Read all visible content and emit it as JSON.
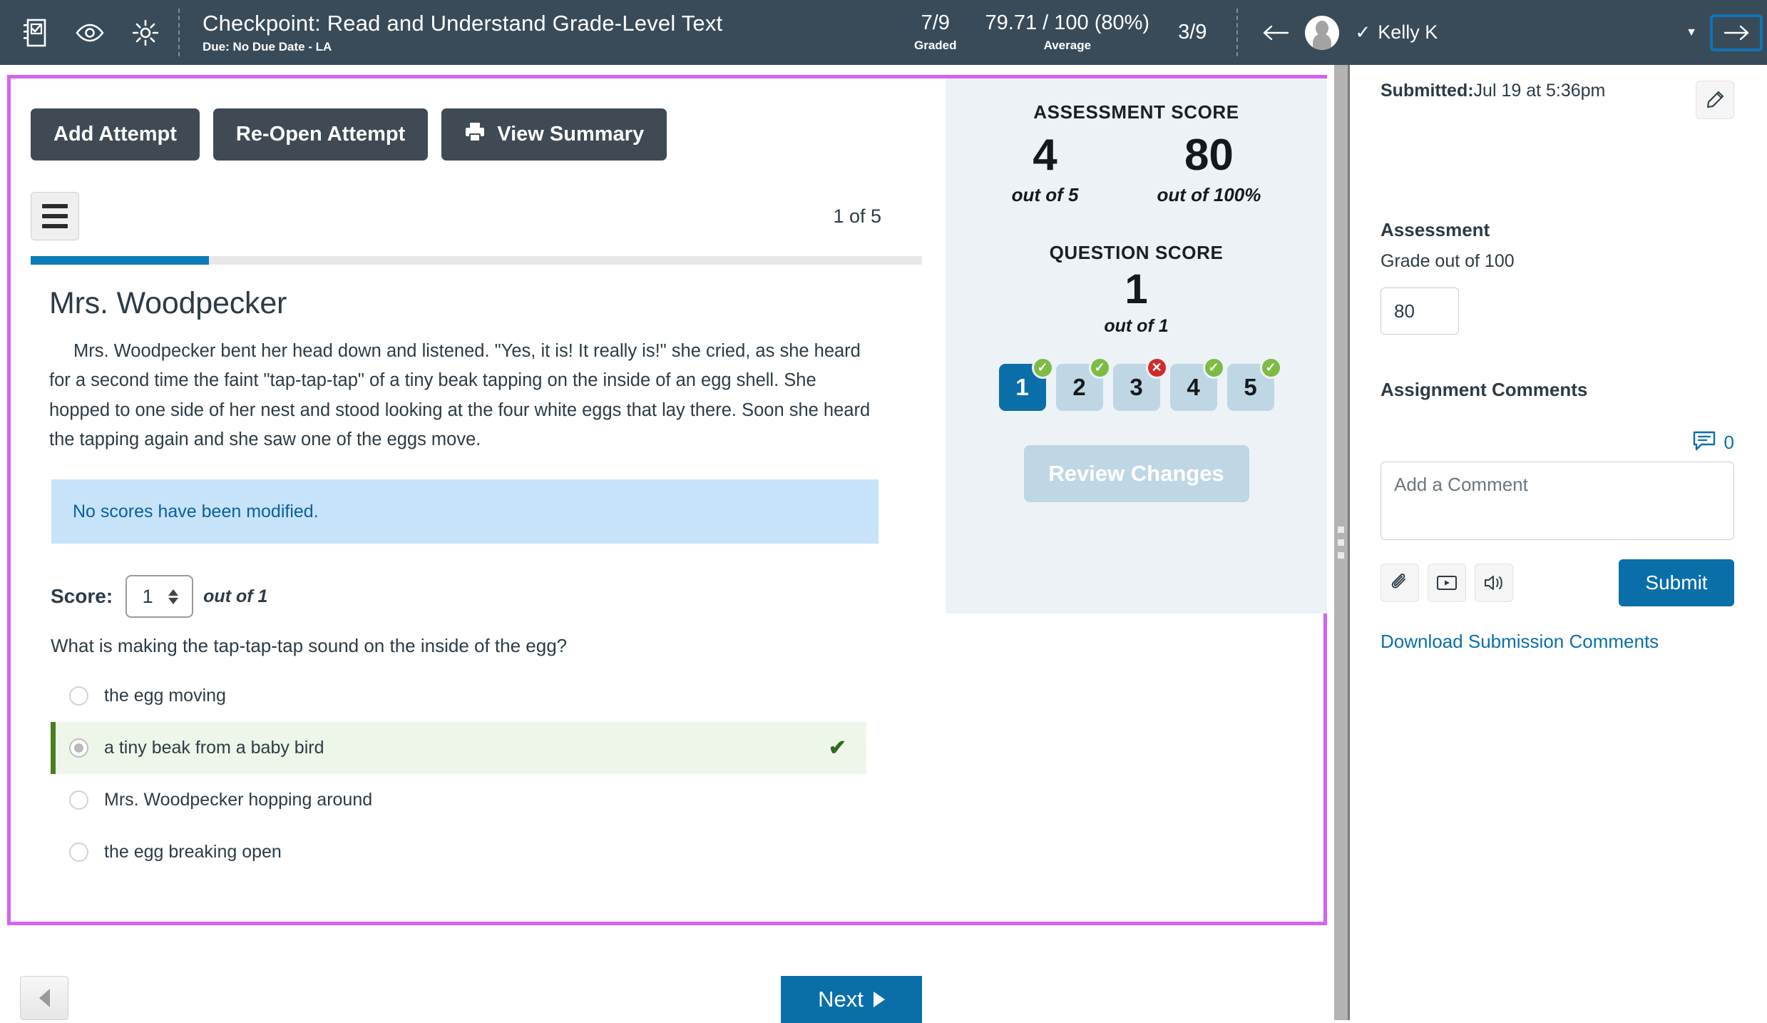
{
  "topbar": {
    "icons": [
      "assignment-icon",
      "eye-icon",
      "gear-icon"
    ],
    "title": "Checkpoint: Read and Understand Grade-Level Text",
    "subtitle": "Due: No Due Date - LA",
    "stats": [
      {
        "value": "7/9",
        "label": "Graded"
      },
      {
        "value": "79.71 / 100 (80%)",
        "label": "Average"
      },
      {
        "value": "3/9",
        "label": ""
      }
    ],
    "student_name": "Kelly K",
    "student_graded_check": "✓",
    "prev_student_icon": "arrow-left-icon",
    "next_student_icon": "arrow-right-icon",
    "dropdown_caret": "▼",
    "accent_blue": "#1074B5",
    "bar_bg": "#394B58"
  },
  "toolbar": {
    "add_attempt": "Add Attempt",
    "reopen_attempt": "Re-Open Attempt",
    "view_summary": "View Summary"
  },
  "viewer": {
    "page_indicator": "1 of 5",
    "progress_percent": 20
  },
  "passage": {
    "title": "Mrs. Woodpecker",
    "body": "Mrs. Woodpecker bent her head down and listened. \"Yes, it is! It really is!\" she cried, as she heard for a second time the faint \"tap-tap-tap\" of a tiny beak tapping on the inside of an egg shell. She hopped to one side of her nest and stood looking at the four white eggs that lay there. Soon she heard the tapping again and she saw one of the eggs move."
  },
  "alert": {
    "text": "No scores have been modified."
  },
  "question": {
    "score_label": "Score:",
    "score_value": "1",
    "score_out_of": "out of 1",
    "prompt": "What is making the tap-tap-tap sound on the inside of the egg?",
    "choices": [
      {
        "label": "the egg moving",
        "selected": false,
        "correct": false
      },
      {
        "label": "a tiny beak from a baby bird",
        "selected": true,
        "correct": true
      },
      {
        "label": "Mrs. Woodpecker hopping around",
        "selected": false,
        "correct": false
      },
      {
        "label": "the egg breaking open",
        "selected": false,
        "correct": false
      }
    ],
    "correct_tick": "✔"
  },
  "score_panel": {
    "assessment_heading": "ASSESSMENT SCORE",
    "points_value": "4",
    "points_out_of": "out of 5",
    "percent_value": "80",
    "percent_out_of": "out of 100%",
    "question_heading": "QUESTION SCORE",
    "question_value": "1",
    "question_out_of": "out of 1",
    "pills": [
      {
        "number": "1",
        "status": "correct",
        "active": true
      },
      {
        "number": "2",
        "status": "correct",
        "active": false
      },
      {
        "number": "3",
        "status": "incorrect",
        "active": false
      },
      {
        "number": "4",
        "status": "correct",
        "active": false
      },
      {
        "number": "5",
        "status": "correct",
        "active": false
      }
    ],
    "review_changes": "Review Changes",
    "panel_bg": "#EDF2F7",
    "active_pill_color": "#0A6FA8",
    "ok_badge_color": "#7DBB42",
    "bad_badge_color": "#D32B2B"
  },
  "sidebar": {
    "submitted_label": "Submitted:",
    "submitted_value": "Jul 19 at 5:36pm",
    "edit_icon": "pencil-icon",
    "assessment_heading": "Assessment",
    "grade_label": "Grade out of 100",
    "grade_value": "80",
    "comments_heading": "Assignment Comments",
    "comment_count": "0",
    "comment_placeholder": "Add a Comment",
    "tools": [
      "paperclip-icon",
      "video-icon",
      "audio-icon"
    ],
    "submit_label": "Submit",
    "download_link": "Download Submission Comments",
    "link_color": "#0A6FA8"
  },
  "bottom_nav": {
    "prev_label": "",
    "next_label": "Next"
  },
  "highlight": {
    "border_color": "#d661f4"
  }
}
